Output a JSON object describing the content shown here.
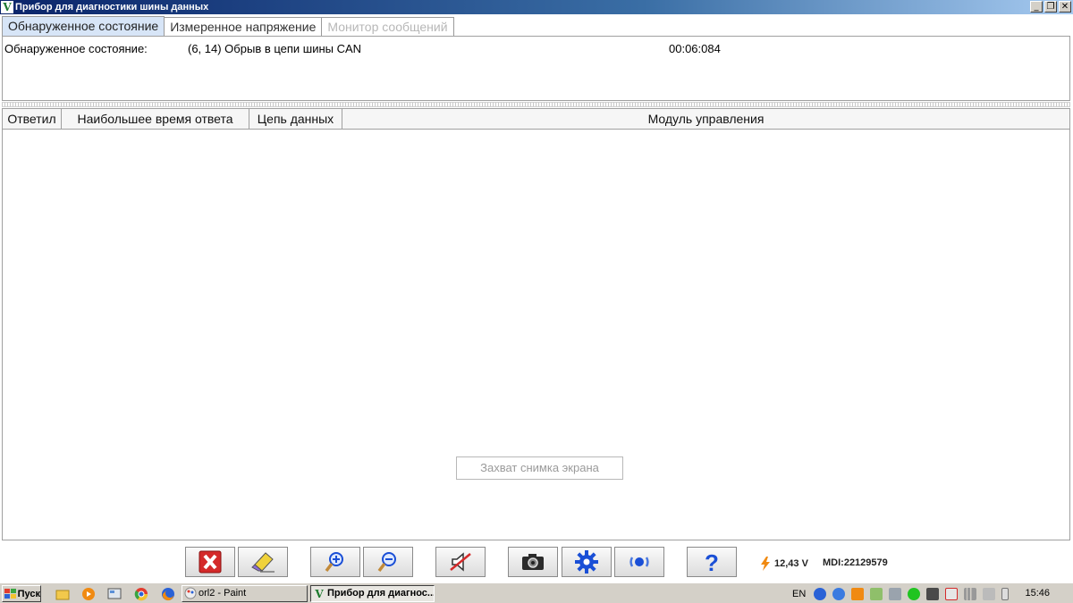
{
  "window": {
    "title": "Прибор для диагностики шины данных",
    "icon_letter": "V"
  },
  "tabs": [
    {
      "label": "Обнаруженное состояние",
      "state": "active"
    },
    {
      "label": "Измеренное напряжение",
      "state": "normal"
    },
    {
      "label": "Монитор сообщений",
      "state": "disabled"
    }
  ],
  "status": {
    "label": "Обнаруженное состояние:",
    "value": "(6, 14) Обрыв в цепи шины CAN",
    "time": "00:06:084"
  },
  "table": {
    "columns": [
      "Ответил",
      "Наибольшее время ответа",
      "Цепь данных",
      "Модуль управления"
    ],
    "rows": []
  },
  "capture_button": "Захват снимка экрана",
  "toolbar": {
    "buttons": [
      {
        "name": "close-red-x-icon"
      },
      {
        "name": "eraser-icon"
      },
      {
        "name": "zoom-in-icon"
      },
      {
        "name": "zoom-out-icon"
      },
      {
        "name": "mute-icon"
      },
      {
        "name": "camera-icon"
      },
      {
        "name": "gear-icon"
      },
      {
        "name": "connection-icon"
      },
      {
        "name": "help-icon"
      }
    ],
    "voltage": "12,43 V",
    "mdi": "MDI:22129579"
  },
  "taskbar": {
    "start": "Пуск",
    "tasks": [
      {
        "label": "orl2 - Paint",
        "state": "inactive"
      },
      {
        "label": "Прибор для диагнос...",
        "state": "active"
      }
    ],
    "language": "EN",
    "clock": "15:46"
  },
  "colors": {
    "accent_tab": "#d7e5f7",
    "title_bar": "#0a246a",
    "help_blue": "#1a4fd6",
    "close_red": "#d42a2a"
  }
}
